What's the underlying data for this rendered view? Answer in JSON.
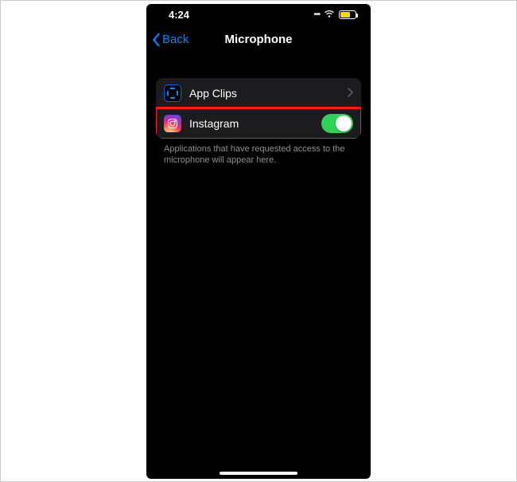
{
  "status": {
    "time": "4:24"
  },
  "nav": {
    "back_label": "Back",
    "title": "Microphone"
  },
  "rows": {
    "appclips": {
      "label": "App Clips"
    },
    "instagram": {
      "label": "Instagram",
      "toggle_on": true
    }
  },
  "footer": {
    "text": "Applications that have requested access to the microphone will appear here."
  }
}
